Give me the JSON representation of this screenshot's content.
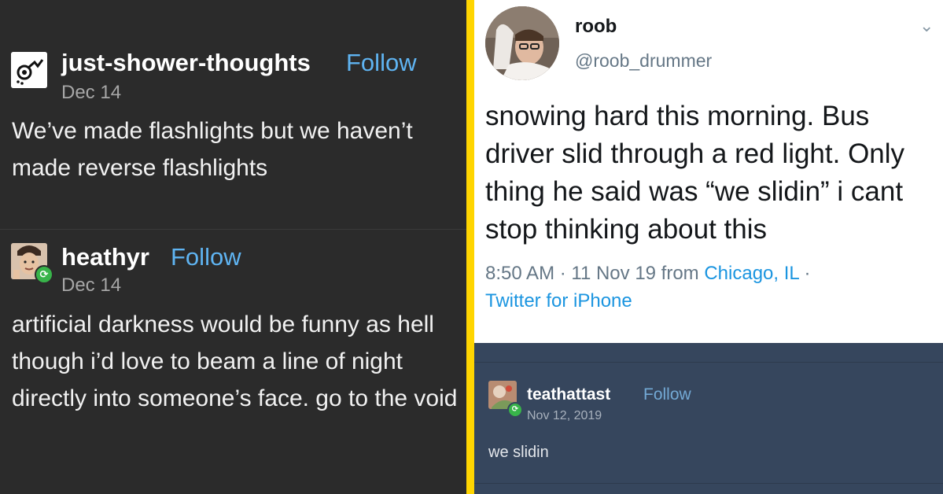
{
  "left_panel": {
    "posts": [
      {
        "username": "just-shower-thoughts",
        "follow_label": "Follow",
        "date": "Dec 14",
        "body": "We’ve made flashlights but we haven’t made reverse flashlights"
      },
      {
        "username": "heathyr",
        "follow_label": "Follow",
        "date": "Dec 14",
        "body": "artificial darkness would be funny as hell though i’d love to beam a line of night directly into someone’s face. go to the void"
      }
    ]
  },
  "tweet": {
    "display_name": "roob",
    "handle": "@roob_drummer",
    "text": "snowing hard this morning. Bus driver slid through a red light. Only thing he said was “we slidin” i cant stop thinking about this",
    "time": "8:50 AM · 11 Nov 19 from ",
    "location": "Chicago, IL",
    "separator": " · ",
    "client": "Twitter for iPhone"
  },
  "reply": {
    "username": "teathattast",
    "follow_label": "Follow",
    "date": "Nov 12, 2019",
    "body": "we slidin"
  },
  "colors": {
    "border_yellow": "#ffd500",
    "tumblr_dark_bg": "#2b2b2b",
    "tumblr_slate_bg": "#36465d",
    "link_blue": "#5fb4f2",
    "twitter_link": "#1b95e0",
    "reblog_green": "#38b44a"
  }
}
